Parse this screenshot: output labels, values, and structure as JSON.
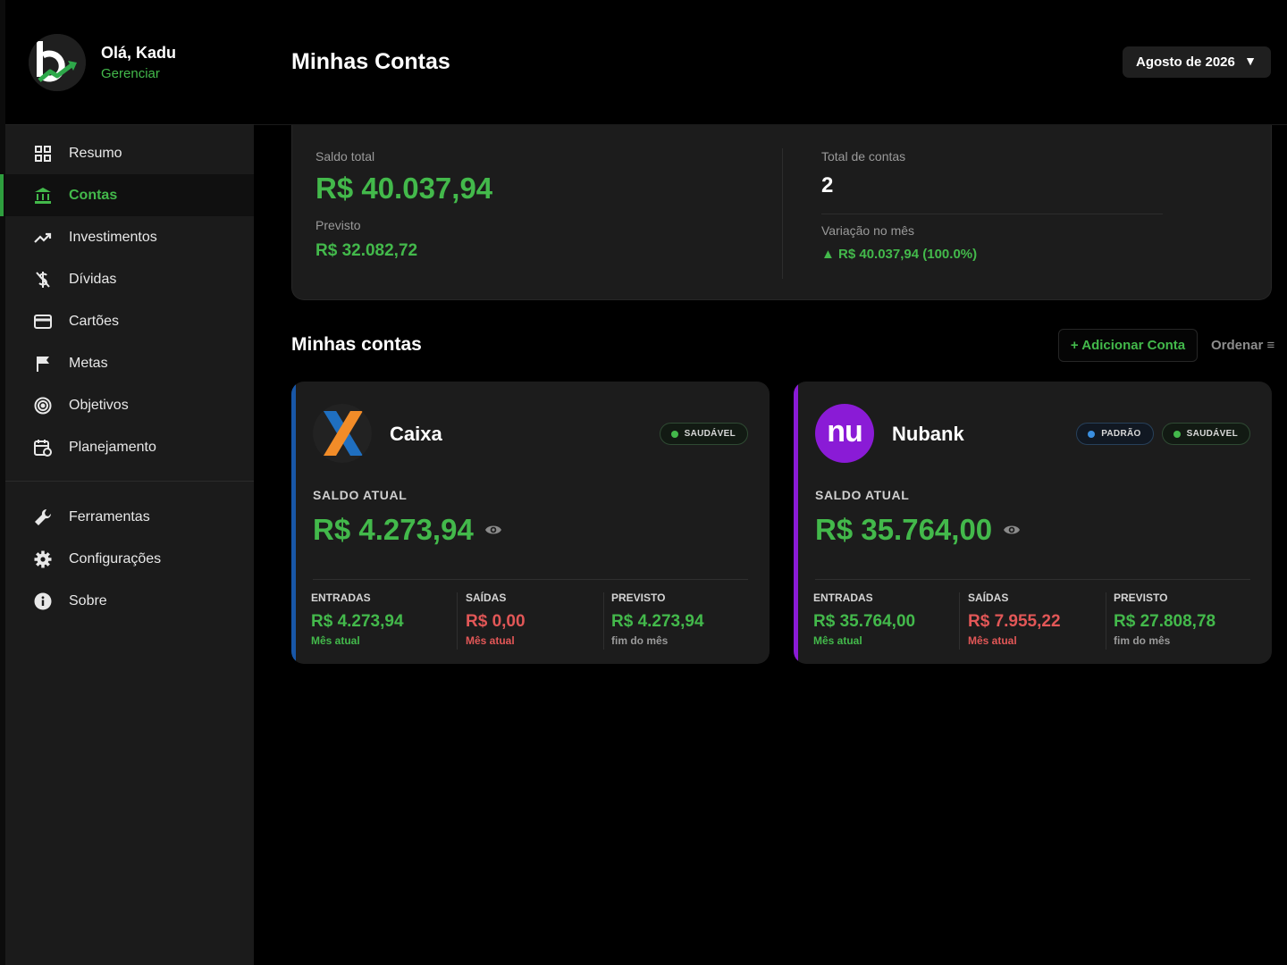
{
  "user": {
    "greeting": "Olá, Kadu",
    "manage_label": "Gerenciar"
  },
  "sidebar": {
    "items": [
      {
        "label": "Resumo",
        "icon": "grid-icon"
      },
      {
        "label": "Contas",
        "icon": "bank-icon",
        "active": true
      },
      {
        "label": "Investimentos",
        "icon": "trending-up-icon"
      },
      {
        "label": "Dívidas",
        "icon": "money-off-icon"
      },
      {
        "label": "Cartões",
        "icon": "credit-card-icon"
      },
      {
        "label": "Metas",
        "icon": "flag-icon"
      },
      {
        "label": "Objetivos",
        "icon": "target-icon"
      },
      {
        "label": "Planejamento",
        "icon": "calendar-icon"
      }
    ],
    "secondary": [
      {
        "label": "Ferramentas",
        "icon": "wrench-icon"
      },
      {
        "label": "Configurações",
        "icon": "gear-icon"
      },
      {
        "label": "Sobre",
        "icon": "info-icon"
      }
    ]
  },
  "header": {
    "title": "Minhas Contas",
    "month": "Agosto de 2026",
    "caret": "▼"
  },
  "summary": {
    "total_label": "Saldo total",
    "total": "R$ 40.037,94",
    "previsto_label": "Previsto",
    "previsto": "R$ 32.082,72",
    "count_label": "Total de contas",
    "count": "2",
    "variation_label": "Variação no mês",
    "variation": "▲ R$ 40.037,94 (100.0%)"
  },
  "section": {
    "title": "Minhas contas",
    "add_label": "+ Adicionar Conta",
    "sort_label": "Ordenar ≡"
  },
  "accounts": [
    {
      "name": "Caixa",
      "stripe_color": "#1857a8",
      "badges": [
        {
          "label": "SAUDÁVEL",
          "color": "#43b94b"
        }
      ],
      "saldo_label": "SALDO ATUAL",
      "saldo": "R$ 4.273,94",
      "entradas_label": "ENTRADAS",
      "entradas": "R$ 4.273,94",
      "entradas_sub": "Mês atual",
      "saidas_label": "SAÍDAS",
      "saidas": "R$ 0,00",
      "saidas_sub": "Mês atual",
      "previsto_label": "PREVISTO",
      "previsto": "R$ 4.273,94",
      "previsto_sub": "fim do mês"
    },
    {
      "name": "Nubank",
      "stripe_color": "#8a1bd6",
      "logo_text": "nu",
      "badges": [
        {
          "label": "PADRÃO",
          "color": "#3a8fe0"
        },
        {
          "label": "SAUDÁVEL",
          "color": "#43b94b"
        }
      ],
      "saldo_label": "SALDO ATUAL",
      "saldo": "R$ 35.764,00",
      "entradas_label": "ENTRADAS",
      "entradas": "R$ 35.764,00",
      "entradas_sub": "Mês atual",
      "saidas_label": "SAÍDAS",
      "saidas": "R$ 7.955,22",
      "saidas_sub": "Mês atual",
      "previsto_label": "PREVISTO",
      "previsto": "R$ 27.808,78",
      "previsto_sub": "fim do mês"
    }
  ],
  "colors": {
    "accent": "#43b94b",
    "negative": "#e25757",
    "background": "#000000",
    "card": "#1c1c1c"
  }
}
